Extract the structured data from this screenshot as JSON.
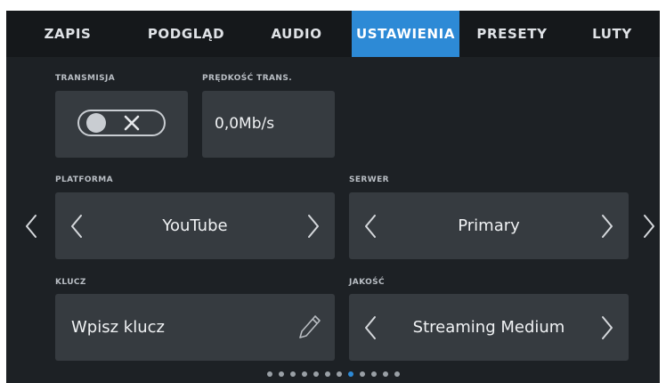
{
  "tabs": [
    {
      "label": "ZAPIS"
    },
    {
      "label": "PODGLĄD"
    },
    {
      "label": "AUDIO"
    },
    {
      "label": "USTAWIENIA"
    },
    {
      "label": "PRESETY"
    },
    {
      "label": "LUTY"
    }
  ],
  "active_tab": "USTAWIENIA",
  "transmission": {
    "label": "TRANSMISJA",
    "state": "off"
  },
  "speed": {
    "label": "PRĘDKOŚĆ TRANS.",
    "value": "0,0Mb/s"
  },
  "platform": {
    "label": "PLATFORMA",
    "value": "YouTube"
  },
  "server": {
    "label": "SERWER",
    "value": "Primary"
  },
  "key": {
    "label": "KLUCZ",
    "placeholder": "Wpisz klucz"
  },
  "quality": {
    "label": "JAKOŚĆ",
    "value": "Streaming Medium"
  },
  "pagination": {
    "total": 12,
    "active_index": 7
  },
  "colors": {
    "accent": "#2d8ad6",
    "background": "#1d2125",
    "panel": "#363b40",
    "tabbar": "#15181b"
  }
}
